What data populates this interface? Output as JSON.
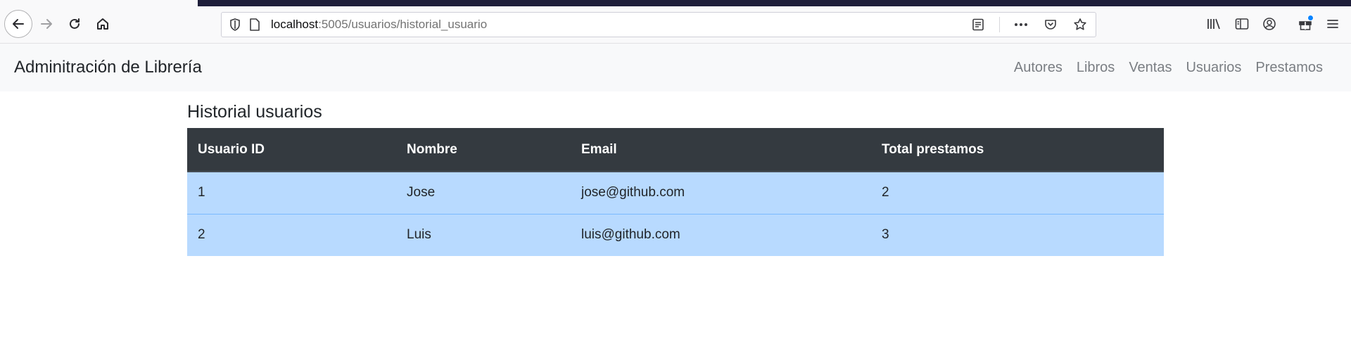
{
  "browser": {
    "url_host": "localhost",
    "url_rest": ":5005/usuarios/historial_usuario",
    "icons": [
      "back-icon",
      "forward-icon",
      "reload-icon",
      "home-icon",
      "shield-icon",
      "page-icon",
      "reader-view-icon",
      "more-icon",
      "pocket-icon",
      "star-icon",
      "library-icon",
      "sidebar-icon",
      "account-icon",
      "gift-icon",
      "menu-icon"
    ]
  },
  "navbar": {
    "brand": "Adminitración de Librería",
    "links": [
      "Autores",
      "Libros",
      "Ventas",
      "Usuarios",
      "Prestamos"
    ]
  },
  "page": {
    "title": "Historial usuarios"
  },
  "table": {
    "headers": [
      "Usuario ID",
      "Nombre",
      "Email",
      "Total prestamos"
    ],
    "rows": [
      [
        "1",
        "Jose",
        "jose@github.com",
        "2"
      ],
      [
        "2",
        "Luis",
        "luis@github.com",
        "3"
      ]
    ],
    "row_color": "#b8daff",
    "header_color": "#343a40"
  }
}
